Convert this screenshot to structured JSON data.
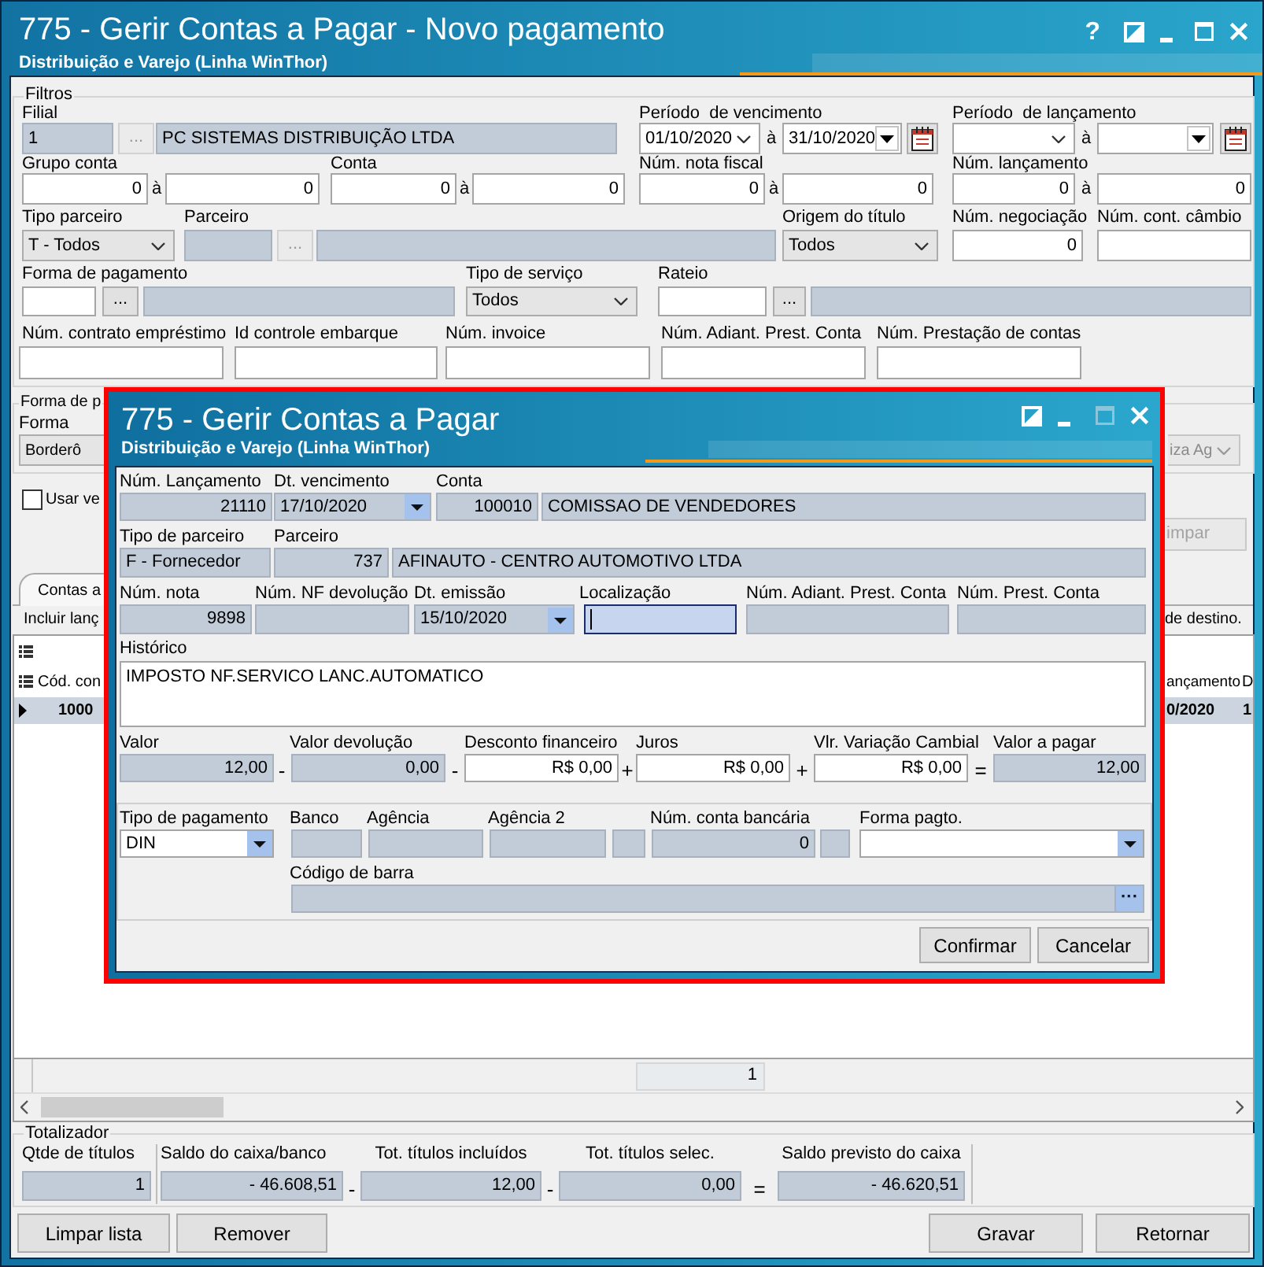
{
  "window": {
    "title": "775 - Gerir Contas a Pagar - Novo pagamento",
    "subtitle": "Distribuição e Varejo (Linha WinThor)",
    "controls": [
      {
        "kind": "help",
        "text": "?",
        "disabled": false
      },
      {
        "kind": "theme",
        "disabled": false
      },
      {
        "kind": "minimize",
        "disabled": false
      },
      {
        "kind": "maximize",
        "disabled": false
      },
      {
        "kind": "close",
        "disabled": false
      }
    ]
  },
  "filters": {
    "legend": "Filtros",
    "fields": [
      {
        "label": "Filial",
        "inputs": [
          {
            "kind": "text",
            "value": "1",
            "disabled": true
          },
          {
            "kind": "lookup",
            "value": "...",
            "disabled": true
          },
          {
            "kind": "text",
            "value": "PC SISTEMAS DISTRIBUIÇÃO LTDA",
            "disabled": true
          }
        ]
      },
      {
        "label": "Período  de vencimento",
        "inputs": [
          {
            "kind": "date",
            "value": "01/10/2020",
            "disabled": false
          },
          {
            "kind": "range",
            "text": "à"
          },
          {
            "kind": "datebox",
            "value": "31/10/2020",
            "disabled": false
          },
          {
            "kind": "calendar",
            "disabled": false
          }
        ]
      },
      {
        "label": "Período  de lançamento",
        "inputs": [
          {
            "kind": "date",
            "disabled": false
          },
          {
            "kind": "range",
            "text": "à"
          },
          {
            "kind": "datebox",
            "disabled": false
          },
          {
            "kind": "calendar",
            "disabled": false
          }
        ]
      },
      {
        "label": "Grupo conta",
        "inputs": [
          {
            "kind": "number",
            "value": "0",
            "disabled": false
          },
          {
            "kind": "range",
            "text": "à"
          },
          {
            "kind": "number",
            "value": "0",
            "disabled": false
          }
        ]
      },
      {
        "label": "Conta",
        "inputs": [
          {
            "kind": "number",
            "value": "0",
            "disabled": false
          },
          {
            "kind": "range",
            "text": "à"
          },
          {
            "kind": "number",
            "value": "0",
            "disabled": false
          }
        ]
      },
      {
        "label": "Núm. nota fiscal",
        "inputs": [
          {
            "kind": "number",
            "value": "0",
            "disabled": false
          },
          {
            "kind": "range",
            "text": "à"
          },
          {
            "kind": "number",
            "value": "0",
            "disabled": false
          }
        ]
      },
      {
        "label": "Núm. lançamento",
        "inputs": [
          {
            "kind": "number",
            "value": "0",
            "disabled": false
          },
          {
            "kind": "range",
            "text": "à"
          },
          {
            "kind": "number",
            "value": "0",
            "disabled": false
          }
        ]
      },
      {
        "label": "Tipo parceiro",
        "inputs": [
          {
            "kind": "combo",
            "value": "T - Todos",
            "disabled": false
          }
        ]
      },
      {
        "label": "Parceiro",
        "inputs": [
          {
            "kind": "text",
            "disabled": true
          },
          {
            "kind": "lookup",
            "value": "...",
            "disabled": true
          },
          {
            "kind": "text",
            "disabled": true
          }
        ]
      },
      {
        "label": "Origem do título",
        "inputs": [
          {
            "kind": "combo",
            "value": "Todos",
            "disabled": false
          }
        ]
      },
      {
        "label": "Núm. negociação",
        "inputs": [
          {
            "kind": "number",
            "value": "0",
            "disabled": false
          }
        ]
      },
      {
        "label": "Núm. cont. câmbio",
        "inputs": [
          {
            "kind": "text",
            "disabled": false
          }
        ]
      },
      {
        "label": "Forma de pagamento",
        "inputs": [
          {
            "kind": "text",
            "disabled": false
          },
          {
            "kind": "lookup",
            "value": "...",
            "disabled": false
          },
          {
            "kind": "text",
            "disabled": true
          }
        ]
      },
      {
        "label": "Tipo de serviço",
        "inputs": [
          {
            "kind": "combo",
            "value": "Todos",
            "disabled": false
          }
        ]
      },
      {
        "label": "Rateio",
        "inputs": [
          {
            "kind": "text",
            "disabled": false
          },
          {
            "kind": "lookup",
            "value": "...",
            "disabled": false
          },
          {
            "kind": "text",
            "disabled": true
          }
        ]
      },
      {
        "label": "Núm. contrato empréstimo",
        "inputs": [
          {
            "kind": "text",
            "disabled": false
          }
        ]
      },
      {
        "label": "Id controle embarque",
        "inputs": [
          {
            "kind": "text",
            "disabled": false
          }
        ]
      },
      {
        "label": "Núm. invoice",
        "inputs": [
          {
            "kind": "text",
            "disabled": false
          }
        ]
      },
      {
        "label": "Núm. Adiant. Prest. Conta",
        "inputs": [
          {
            "kind": "text",
            "disabled": false
          }
        ]
      },
      {
        "label": "Núm. Prestação de contas",
        "inputs": [
          {
            "kind": "text",
            "disabled": false
          }
        ]
      }
    ]
  },
  "payment_group": {
    "legend": "Forma de p",
    "label": "Forma",
    "combo_1": {
      "value": "Borderô",
      "disabled": false
    },
    "combo_2": {
      "value": "iza Ag",
      "disabled": true
    }
  },
  "checkbox": {
    "label": "Usar ve",
    "checked": false
  },
  "side_button": {
    "label": "impar",
    "disabled": true
  },
  "tabs": [
    {
      "label": "Contas a",
      "selected": true
    }
  ],
  "toolbar": {
    "left_text": "Incluir lanç",
    "right_text": "de destino."
  },
  "grid": {
    "columns": [
      "Cód. con",
      "ançamento",
      "D"
    ],
    "rows": [
      {
        "selected": true,
        "cells": [
          "1000",
          "0/2020",
          "1"
        ]
      }
    ],
    "footer": [
      "1"
    ]
  },
  "totals": {
    "legend": "Totalizador",
    "fields": [
      {
        "label": "Qtde de títulos",
        "inputs": [
          {
            "kind": "number",
            "value": "1",
            "disabled": true
          }
        ]
      },
      {
        "label": "Saldo do caixa/banco",
        "inputs": [
          {
            "kind": "number",
            "value": "- 46.608,51",
            "disabled": true
          },
          {
            "kind": "operator",
            "text": "-"
          }
        ]
      },
      {
        "label": "Tot. títulos incluídos",
        "inputs": [
          {
            "kind": "number",
            "value": "12,00",
            "disabled": true
          },
          {
            "kind": "operator",
            "text": "-"
          }
        ]
      },
      {
        "label": "Tot. títulos selec.",
        "inputs": [
          {
            "kind": "number",
            "value": "0,00",
            "disabled": true
          },
          {
            "kind": "operator",
            "text": "="
          }
        ]
      },
      {
        "label": "Saldo previsto do caixa",
        "inputs": [
          {
            "kind": "number",
            "value": "- 46.620,51",
            "disabled": true
          }
        ]
      }
    ]
  },
  "buttons": {
    "left": [
      "Limpar lista",
      "Remover"
    ],
    "right": [
      "Gravar",
      "Retornar"
    ]
  },
  "dialog": {
    "title": "775 - Gerir Contas a Pagar",
    "subtitle": "Distribuição e Varejo (Linha WinThor)",
    "controls": [
      {
        "kind": "theme",
        "disabled": false
      },
      {
        "kind": "minimize",
        "disabled": false
      },
      {
        "kind": "maximize",
        "disabled": true
      },
      {
        "kind": "close",
        "disabled": false
      }
    ],
    "fields": [
      {
        "label": "Núm. Lançamento",
        "inputs": [
          {
            "kind": "number",
            "value": "21110",
            "disabled": true
          }
        ]
      },
      {
        "label": "Dt. vencimento",
        "inputs": [
          {
            "kind": "datepicker",
            "value": "17/10/2020",
            "disabled": true
          }
        ]
      },
      {
        "label": "Conta",
        "inputs": [
          {
            "kind": "number",
            "value": "100010",
            "disabled": true
          },
          {
            "kind": "text",
            "value": "COMISSAO DE VENDEDORES",
            "disabled": true
          }
        ]
      },
      {
        "label": "Tipo de parceiro",
        "inputs": [
          {
            "kind": "text",
            "value": "F - Fornecedor",
            "disabled": true
          }
        ]
      },
      {
        "label": "Parceiro",
        "inputs": [
          {
            "kind": "number",
            "value": "737",
            "disabled": true
          },
          {
            "kind": "text",
            "value": "AFINAUTO - CENTRO AUTOMOTIVO LTDA",
            "disabled": true
          }
        ]
      },
      {
        "label": "Núm. nota",
        "inputs": [
          {
            "kind": "number",
            "value": "9898",
            "disabled": true
          }
        ]
      },
      {
        "label": "Núm. NF devolução",
        "inputs": [
          {
            "kind": "text",
            "disabled": true
          }
        ]
      },
      {
        "label": "Dt. emissão",
        "inputs": [
          {
            "kind": "datepicker",
            "value": "15/10/2020",
            "disabled": true
          }
        ]
      },
      {
        "label": "Localização",
        "inputs": [
          {
            "kind": "text",
            "disabled": false,
            "focused": true
          }
        ]
      },
      {
        "label": "Núm. Adiant. Prest. Conta",
        "inputs": [
          {
            "kind": "text",
            "disabled": true
          }
        ]
      },
      {
        "label": "Núm. Prest. Conta",
        "inputs": [
          {
            "kind": "text",
            "disabled": true
          }
        ]
      },
      {
        "label": "Histórico",
        "inputs": [
          {
            "kind": "memo",
            "value": "IMPOSTO NF.SERVICO LANC.AUTOMATICO",
            "disabled": false
          }
        ]
      },
      {
        "label": "Valor",
        "inputs": [
          {
            "kind": "number",
            "value": "12,00",
            "disabled": true
          },
          {
            "kind": "operator",
            "text": "-"
          }
        ]
      },
      {
        "label": "Valor devolução",
        "inputs": [
          {
            "kind": "number",
            "value": "0,00",
            "disabled": true
          },
          {
            "kind": "operator",
            "text": "-"
          }
        ]
      },
      {
        "label": "Desconto financeiro",
        "inputs": [
          {
            "kind": "number",
            "value": "R$ 0,00",
            "disabled": false
          },
          {
            "kind": "operator",
            "text": "+"
          }
        ]
      },
      {
        "label": "Juros",
        "inputs": [
          {
            "kind": "number",
            "value": "R$ 0,00",
            "disabled": false
          },
          {
            "kind": "operator",
            "text": "+"
          }
        ]
      },
      {
        "label": "Vlr. Variação Cambial",
        "inputs": [
          {
            "kind": "number",
            "value": "R$ 0,00",
            "disabled": false
          },
          {
            "kind": "operator",
            "text": "="
          }
        ]
      },
      {
        "label": "Valor a pagar",
        "inputs": [
          {
            "kind": "number",
            "value": "12,00",
            "disabled": true
          }
        ]
      }
    ],
    "payment": {
      "fields": [
        {
          "label": "Tipo de pagamento",
          "inputs": [
            {
              "kind": "picker",
              "value": "DIN",
              "disabled": false
            }
          ]
        },
        {
          "label": "Banco",
          "inputs": [
            {
              "kind": "text",
              "disabled": true
            }
          ]
        },
        {
          "label": "Agência",
          "inputs": [
            {
              "kind": "text",
              "disabled": true
            }
          ]
        },
        {
          "label": "Agência 2",
          "inputs": [
            {
              "kind": "text",
              "disabled": true
            },
            {
              "kind": "text",
              "disabled": true
            }
          ]
        },
        {
          "label": "Núm. conta bancária",
          "inputs": [
            {
              "kind": "number",
              "value": "0",
              "disabled": true
            },
            {
              "kind": "text",
              "disabled": true
            }
          ]
        },
        {
          "label": "Forma pagto.",
          "inputs": [
            {
              "kind": "picker",
              "disabled": false
            }
          ]
        },
        {
          "label": "Código de barra",
          "inputs": [
            {
              "kind": "text",
              "disabled": true
            },
            {
              "kind": "lookup",
              "value": "···",
              "disabled": false
            }
          ]
        }
      ]
    },
    "buttons": [
      "Confirmar",
      "Cancelar"
    ]
  }
}
